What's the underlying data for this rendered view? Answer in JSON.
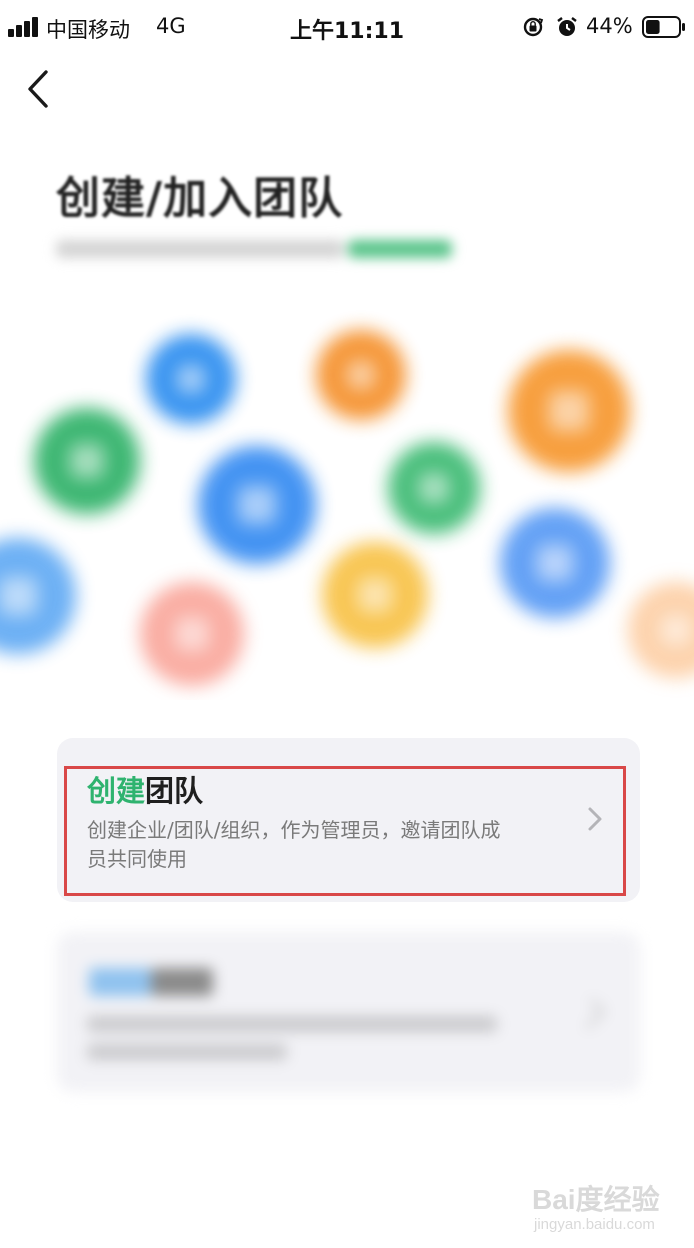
{
  "status_bar": {
    "carrier": "中国移动",
    "network": "4G",
    "time": "上午11:11",
    "battery_percent": "44%",
    "battery_level": 0.44,
    "icons": [
      "signal-icon",
      "rotation-lock-icon",
      "alarm-icon",
      "battery-icon"
    ]
  },
  "nav": {
    "back_icon": "chevron-left-icon"
  },
  "header": {
    "title": "创建/加入团队"
  },
  "decor": {
    "bubble_colors": [
      "#2f8ff0",
      "#f5922f",
      "#f79a34",
      "#33b36b",
      "#3a8ef2",
      "#3fbb74",
      "#5b9cf5",
      "#f8c34a",
      "#f88b7c",
      "#fcc08a"
    ]
  },
  "cards": {
    "create": {
      "title_accent": "创建",
      "title_rest": "团队",
      "description": "创建企业/团队/组织，作为管理员，邀请团队成员共同使用",
      "chevron_icon": "chevron-right-icon",
      "accent_color": "#2fb36f",
      "highlight_color": "#d94848"
    },
    "join": {
      "chevron_icon": "chevron-right-icon"
    }
  },
  "watermark": {
    "brand": "Bai度经验",
    "url": "jingyan.baidu.com"
  }
}
